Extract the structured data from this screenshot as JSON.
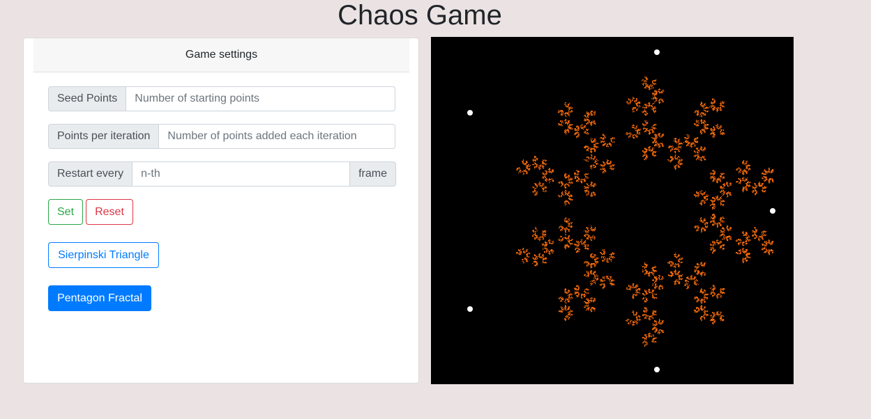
{
  "page": {
    "title": "Chaos Game"
  },
  "settings": {
    "header": "Game settings",
    "seed_points": {
      "label": "Seed Points",
      "placeholder": "Number of starting points",
      "value": ""
    },
    "points_per_iteration": {
      "label": "Points per iteration",
      "placeholder": "Number of points added each iteration",
      "value": ""
    },
    "restart_every": {
      "label": "Restart every",
      "placeholder": "n-th",
      "suffix": "frame",
      "value": ""
    },
    "buttons": {
      "set": "Set",
      "reset": "Reset",
      "sierpinski": "Sierpinski Triangle",
      "pentagon": "Pentagon Fractal"
    }
  },
  "canvas": {
    "background": "#000000",
    "point_color": "#e8650a",
    "vertex_color": "#ffffff",
    "fractal": "pentagon",
    "vertex_count": 5
  }
}
